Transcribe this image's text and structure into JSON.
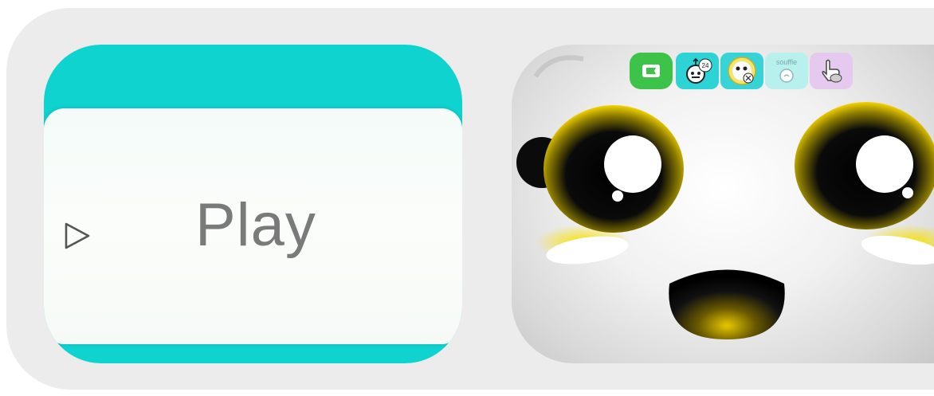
{
  "play_button": {
    "label": "Play",
    "icon": "play-triangle-icon",
    "accent_color": "#0fd3cf"
  },
  "game_preview": {
    "toolbar": {
      "items": [
        {
          "icon": "green-flag-icon",
          "color": "#3ec34a"
        },
        {
          "icon": "robot-timer-icon",
          "badge": "24",
          "color": "#2ed3d6"
        },
        {
          "icon": "character-face-icon",
          "color": "#37d3d6"
        },
        {
          "icon": "speech-bubble-icon",
          "label": "souffle",
          "color": "#b8f0ee"
        },
        {
          "icon": "hand-tap-icon",
          "color": "#e6c9ee"
        }
      ]
    },
    "character": "panda-face",
    "eye_color": "#f5d400"
  }
}
